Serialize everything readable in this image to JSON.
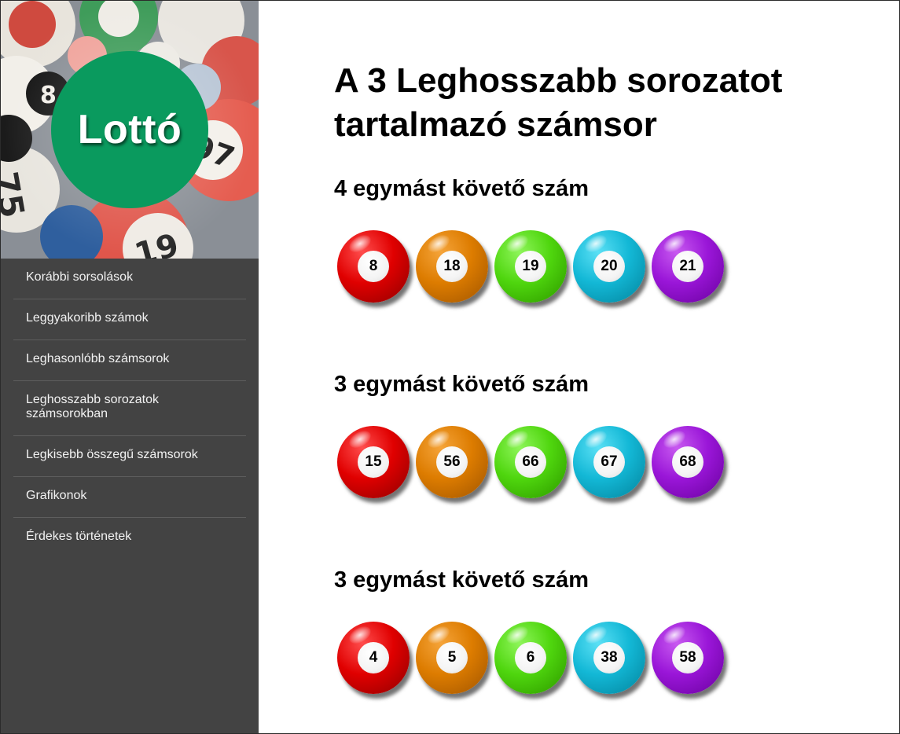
{
  "brand": {
    "logo_text": "Lottó",
    "logo_color": "#0a9a5e"
  },
  "sidebar": {
    "background": "#434343",
    "items": [
      {
        "label": "Korábbi sorsolások"
      },
      {
        "label": "Leggyakoribb számok"
      },
      {
        "label": "Leghasonlóbb számsorok"
      },
      {
        "label": "Leghosszabb sorozatok számsorokban"
      },
      {
        "label": "Legkisebb összegű számsorok"
      },
      {
        "label": "Grafikonok"
      },
      {
        "label": "Érdekes történetek"
      }
    ]
  },
  "main": {
    "title": "A 3 Leghosszabb sorozatot tartalmazó számsor",
    "sections": [
      {
        "heading": "4 egymást követő szám",
        "numbers": [
          "8",
          "18",
          "19",
          "20",
          "21"
        ]
      },
      {
        "heading": "3 egymást követő szám",
        "numbers": [
          "15",
          "56",
          "66",
          "67",
          "68"
        ]
      },
      {
        "heading": "3 egymást követő szám",
        "numbers": [
          "4",
          "5",
          "6",
          "38",
          "58"
        ]
      }
    ],
    "ball_colors": [
      "red",
      "orange",
      "green",
      "cyan",
      "purple"
    ]
  }
}
